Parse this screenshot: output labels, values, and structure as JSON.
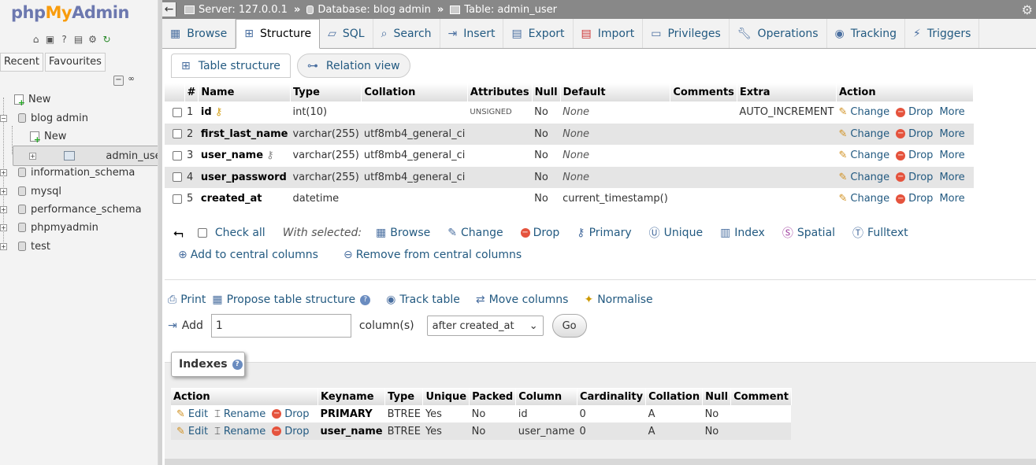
{
  "app": {
    "logo_php": "php",
    "logo_my": "My",
    "logo_admin": "Admin"
  },
  "sidebar": {
    "tabs": [
      "Recent",
      "Favourites"
    ],
    "tree": [
      {
        "label": "New"
      },
      {
        "label": "blog admin"
      },
      {
        "label": "New"
      },
      {
        "label": "admin_user"
      },
      {
        "label": "information_schema"
      },
      {
        "label": "mysql"
      },
      {
        "label": "performance_schema"
      },
      {
        "label": "phpmyadmin"
      },
      {
        "label": "test"
      }
    ]
  },
  "breadcrumb": {
    "server": "Server: 127.0.0.1",
    "database": "Database: blog admin",
    "table": "Table: admin_user",
    "separator": "»"
  },
  "menu": {
    "tabs": [
      {
        "label": "Browse"
      },
      {
        "label": "Structure"
      },
      {
        "label": "SQL"
      },
      {
        "label": "Search"
      },
      {
        "label": "Insert"
      },
      {
        "label": "Export"
      },
      {
        "label": "Import"
      },
      {
        "label": "Privileges"
      },
      {
        "label": "Operations"
      },
      {
        "label": "Tracking"
      },
      {
        "label": "Triggers"
      }
    ],
    "active": "Structure"
  },
  "subtabs": {
    "table_structure": "Table structure",
    "relation_view": "Relation view"
  },
  "structure": {
    "headers": [
      "#",
      "Name",
      "Type",
      "Collation",
      "Attributes",
      "Null",
      "Default",
      "Comments",
      "Extra",
      "Action"
    ],
    "rows": [
      {
        "num": "1",
        "name": "id",
        "type": "int(10)",
        "collation": "",
        "attributes": "UNSIGNED",
        "null": "No",
        "default": "None",
        "comments": "",
        "extra": "AUTO_INCREMENT",
        "key": "primary"
      },
      {
        "num": "2",
        "name": "first_last_name",
        "type": "varchar(255)",
        "collation": "utf8mb4_general_ci",
        "attributes": "",
        "null": "No",
        "default": "None",
        "comments": "",
        "extra": "",
        "key": ""
      },
      {
        "num": "3",
        "name": "user_name",
        "type": "varchar(255)",
        "collation": "utf8mb4_general_ci",
        "attributes": "",
        "null": "No",
        "default": "None",
        "comments": "",
        "extra": "",
        "key": "unique"
      },
      {
        "num": "4",
        "name": "user_password",
        "type": "varchar(255)",
        "collation": "utf8mb4_general_ci",
        "attributes": "",
        "null": "No",
        "default": "None",
        "comments": "",
        "extra": "",
        "key": ""
      },
      {
        "num": "5",
        "name": "created_at",
        "type": "datetime",
        "collation": "",
        "attributes": "",
        "null": "No",
        "default": "current_timestamp()",
        "comments": "",
        "extra": "",
        "key": ""
      }
    ],
    "actions": {
      "change": "Change",
      "drop": "Drop",
      "more": "More"
    }
  },
  "bulk": {
    "check_all": "Check all",
    "with_selected": "With selected:",
    "browse": "Browse",
    "change": "Change",
    "drop": "Drop",
    "primary": "Primary",
    "unique": "Unique",
    "index": "Index",
    "spatial": "Spatial",
    "fulltext": "Fulltext",
    "add_central": "Add to central columns",
    "remove_central": "Remove from central columns"
  },
  "tools": {
    "print": "Print",
    "propose": "Propose table structure",
    "track": "Track table",
    "move": "Move columns",
    "normalise": "Normalise"
  },
  "add_columns": {
    "label": "Add",
    "count": "1",
    "unit": "column(s)",
    "position": "after created_at",
    "go": "Go"
  },
  "indexes": {
    "title": "Indexes",
    "headers": [
      "Action",
      "Keyname",
      "Type",
      "Unique",
      "Packed",
      "Column",
      "Cardinality",
      "Collation",
      "Null",
      "Comment"
    ],
    "actions": {
      "edit": "Edit",
      "rename": "Rename",
      "drop": "Drop"
    },
    "rows": [
      {
        "keyname": "PRIMARY",
        "type": "BTREE",
        "unique": "Yes",
        "packed": "No",
        "column": "id",
        "cardinality": "0",
        "collation": "A",
        "null": "No",
        "comment": ""
      },
      {
        "keyname": "user_name",
        "type": "BTREE",
        "unique": "Yes",
        "packed": "No",
        "column": "user_name",
        "cardinality": "0",
        "collation": "A",
        "null": "No",
        "comment": ""
      }
    ]
  }
}
